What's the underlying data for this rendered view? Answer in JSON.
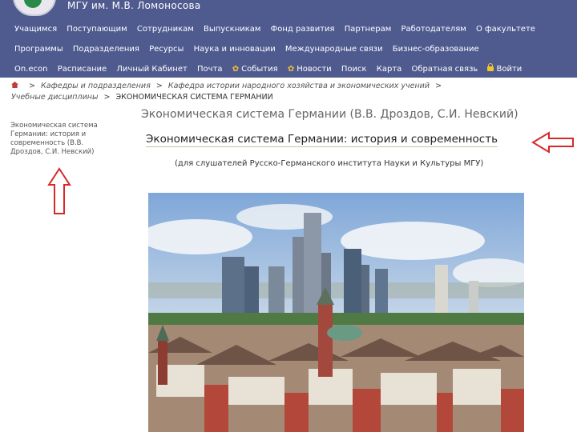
{
  "header": {
    "title": "МГУ им. М.В. Ломоносова",
    "nav_row1": [
      "Учащимся",
      "Поступающим",
      "Сотрудникам",
      "Выпускникам",
      "Фонд развития",
      "Партнерам",
      "Работодателям",
      "О факультете"
    ],
    "nav_row2": [
      "Программы",
      "Подразделения",
      "Ресурсы",
      "Наука и инновации",
      "Международные связи",
      "Бизнес-образование"
    ],
    "nav_row3": {
      "items": [
        "On.econ",
        "Расписание",
        "Личный Кабинет",
        "Почта"
      ],
      "events": "События",
      "news": "Новости",
      "search": "Поиск",
      "map": "Карта",
      "feedback": "Обратная связь",
      "login": "Войти"
    }
  },
  "breadcrumb": {
    "items": [
      "Кафедры и подразделения",
      "Кафедра истории народного хозяйства и экономических учений",
      "Учебные дисциплины"
    ],
    "current": "ЭКОНОМИЧЕСКАЯ СИСТЕМА ГЕРМАНИИ"
  },
  "sidebar": {
    "link": "Экономическая система Германии: история и современность (В.В. Дроздов, С.И. Невский)"
  },
  "main": {
    "title": "Экономическая система Германии (В.В. Дроздов, С.И. Невский)",
    "subtitle": "Экономическая система Германии: история и современность",
    "audience": "(для слушателей Русско-Германского института Науки и Культуры МГУ)"
  },
  "colors": {
    "header_bg": "#4f5a8f",
    "arrow": "#d62a2a",
    "accent_icon": "#f4c430"
  },
  "icons": [
    "logo",
    "home-icon",
    "events-icon",
    "news-icon",
    "lock-icon",
    "red-arrow-up",
    "red-arrow-left"
  ]
}
